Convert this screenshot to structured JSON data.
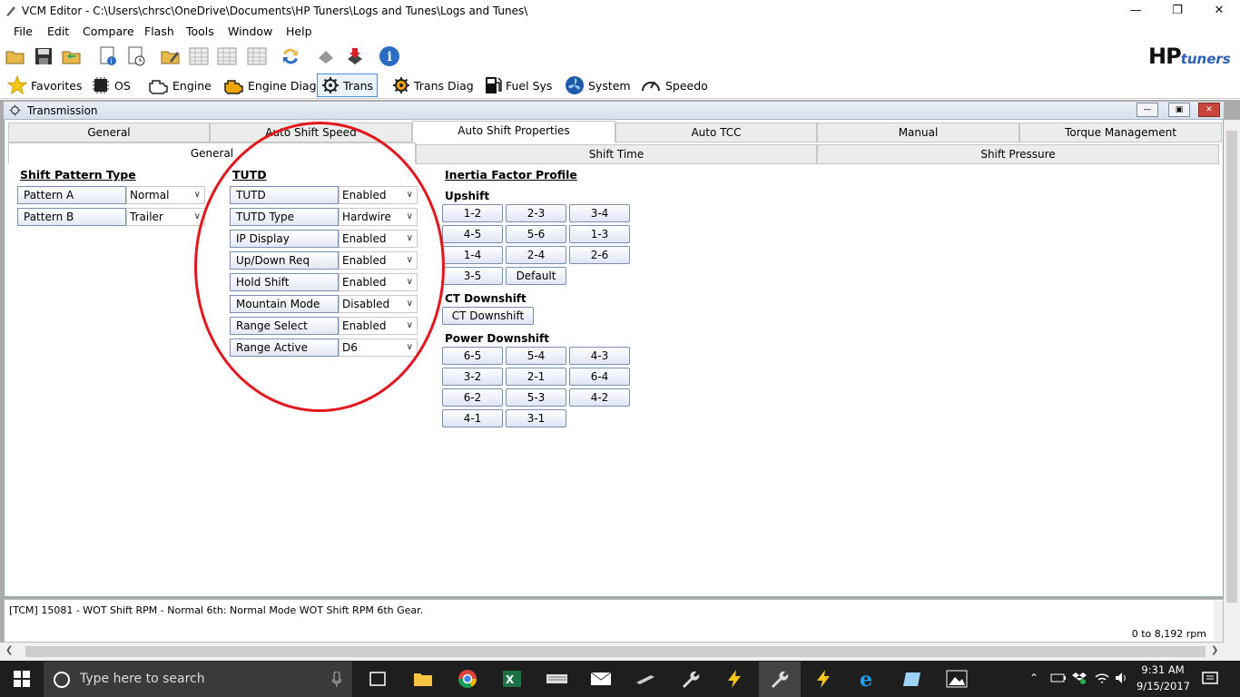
{
  "window": {
    "title": "VCM Editor - C:\\Users\\chrsc\\OneDrive\\Documents\\HP Tuners\\Logs and Tunes\\Logs and Tunes\\"
  },
  "menu": [
    "File",
    "Edit",
    "Compare",
    "Flash",
    "Tools",
    "Window",
    "Help"
  ],
  "brand": {
    "hp": "HP",
    "tuners": "tuners"
  },
  "categories": [
    {
      "label": "Favorites",
      "icon": "star-icon"
    },
    {
      "label": "OS",
      "icon": "chip-icon"
    },
    {
      "label": "Engine",
      "icon": "engine-icon"
    },
    {
      "label": "Engine Diag",
      "icon": "engine-diag-icon"
    },
    {
      "label": "Trans",
      "icon": "gear-icon"
    },
    {
      "label": "Trans Diag",
      "icon": "gear-diag-icon"
    },
    {
      "label": "Fuel Sys",
      "icon": "fuel-pump-icon"
    },
    {
      "label": "System",
      "icon": "fan-icon"
    },
    {
      "label": "Speedo",
      "icon": "speedometer-icon"
    }
  ],
  "child": {
    "title": "Transmission"
  },
  "tabs": [
    "General",
    "Auto Shift Speed",
    "Auto Shift Properties",
    "Auto TCC",
    "Manual",
    "Torque Management"
  ],
  "subtabs": [
    "General",
    "Shift Time",
    "Shift Pressure"
  ],
  "shift_pattern": {
    "title": "Shift Pattern Type",
    "rows": [
      {
        "label": "Pattern A",
        "value": "Normal"
      },
      {
        "label": "Pattern B",
        "value": "Trailer"
      }
    ]
  },
  "tutd": {
    "title": "TUTD",
    "rows": [
      {
        "label": "TUTD",
        "value": "Enabled"
      },
      {
        "label": "TUTD Type",
        "value": "Hardwire"
      },
      {
        "label": "IP Display",
        "value": "Enabled"
      },
      {
        "label": "Up/Down Req",
        "value": "Enabled"
      },
      {
        "label": "Hold Shift",
        "value": "Enabled"
      },
      {
        "label": "Mountain Mode",
        "value": "Disabled"
      },
      {
        "label": "Range Select",
        "value": "Enabled"
      },
      {
        "label": "Range Active",
        "value": "D6"
      }
    ]
  },
  "inertia": {
    "title": "Inertia Factor Profile",
    "upshift_title": "Upshift",
    "upshift": [
      "1-2",
      "2-3",
      "3-4",
      "4-5",
      "5-6",
      "1-3",
      "1-4",
      "2-4",
      "2-6",
      "3-5",
      "Default"
    ],
    "ct_title": "CT Downshift",
    "ct": [
      "CT Downshift"
    ],
    "power_title": "Power Downshift",
    "power": [
      "6-5",
      "5-4",
      "4-3",
      "3-2",
      "2-1",
      "6-4",
      "6-2",
      "5-3",
      "4-2",
      "4-1",
      "3-1"
    ]
  },
  "status": {
    "description": "[TCM] 15081 - WOT Shift RPM - Normal 6th: Normal Mode WOT Shift RPM 6th Gear.",
    "range": "0 to 8,192 rpm"
  },
  "taskbar": {
    "search_placeholder": "Type here to search",
    "time": "9:31 AM",
    "date": "9/15/2017"
  },
  "colors": {
    "accent": "#4a8fd8",
    "annotation_circle": "#e3161d",
    "taskbar": "#1e1e1e"
  }
}
